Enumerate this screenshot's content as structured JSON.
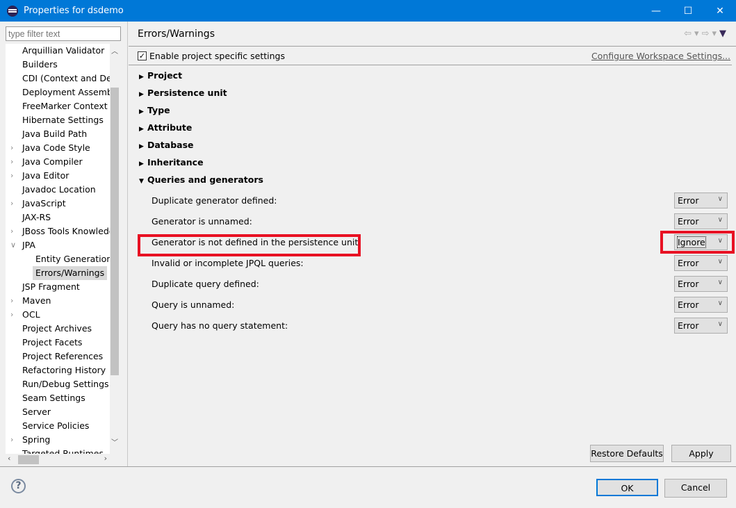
{
  "window": {
    "title": "Properties for dsdemo",
    "minimize": "—",
    "maximize": "☐",
    "close": "✕"
  },
  "sidebar": {
    "filter_placeholder": "type filter text",
    "items": [
      {
        "label": "Arquillian Validator",
        "expandable": false
      },
      {
        "label": "Builders",
        "expandable": false
      },
      {
        "label": "CDI (Context and Dependency Injection)",
        "expandable": false
      },
      {
        "label": "Deployment Assembly",
        "expandable": false
      },
      {
        "label": "FreeMarker Context",
        "expandable": false
      },
      {
        "label": "Hibernate Settings",
        "expandable": false
      },
      {
        "label": "Java Build Path",
        "expandable": false
      },
      {
        "label": "Java Code Style",
        "expandable": true
      },
      {
        "label": "Java Compiler",
        "expandable": true
      },
      {
        "label": "Java Editor",
        "expandable": true
      },
      {
        "label": "Javadoc Location",
        "expandable": false
      },
      {
        "label": "JavaScript",
        "expandable": true
      },
      {
        "label": "JAX-RS",
        "expandable": false
      },
      {
        "label": "JBoss Tools Knowledge Base",
        "expandable": true
      },
      {
        "label": "JPA",
        "expandable": true,
        "expanded": true
      },
      {
        "label": "Entity Generation",
        "child": true
      },
      {
        "label": "Errors/Warnings",
        "child": true,
        "selected": true
      },
      {
        "label": "JSP Fragment",
        "expandable": false
      },
      {
        "label": "Maven",
        "expandable": true
      },
      {
        "label": "OCL",
        "expandable": true
      },
      {
        "label": "Project Archives",
        "expandable": false
      },
      {
        "label": "Project Facets",
        "expandable": false
      },
      {
        "label": "Project References",
        "expandable": false
      },
      {
        "label": "Refactoring History",
        "expandable": false
      },
      {
        "label": "Run/Debug Settings",
        "expandable": false
      },
      {
        "label": "Seam Settings",
        "expandable": false
      },
      {
        "label": "Server",
        "expandable": false
      },
      {
        "label": "Service Policies",
        "expandable": false
      },
      {
        "label": "Spring",
        "expandable": true
      },
      {
        "label": "Targeted Runtimes",
        "expandable": false
      }
    ]
  },
  "main": {
    "heading": "Errors/Warnings",
    "enable_label": "Enable project specific settings",
    "enable_checked": true,
    "configure_link": "Configure Workspace Settings...",
    "sections": [
      "Project",
      "Persistence unit",
      "Type",
      "Attribute",
      "Database",
      "Inheritance"
    ],
    "expanded_section": "Queries and generators",
    "options": [
      {
        "label": "Duplicate generator defined:",
        "value": "Error"
      },
      {
        "label": "Generator is unnamed:",
        "value": "Error"
      },
      {
        "label": "Generator is not defined in the persistence unit:",
        "value": "Ignore",
        "highlighted": true
      },
      {
        "label": "Invalid or incomplete JPQL queries:",
        "value": "Error"
      },
      {
        "label": "Duplicate query defined:",
        "value": "Error"
      },
      {
        "label": "Query is unnamed:",
        "value": "Error"
      },
      {
        "label": "Query has no query statement:",
        "value": "Error"
      }
    ],
    "restore_defaults": "Restore Defaults",
    "apply": "Apply"
  },
  "footer": {
    "ok": "OK",
    "cancel": "Cancel",
    "help": "?"
  },
  "colors": {
    "titlebar": "#0078d7",
    "highlight": "#e81123"
  }
}
